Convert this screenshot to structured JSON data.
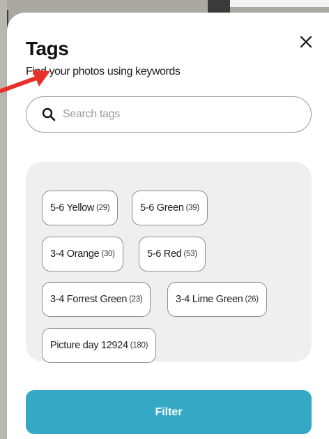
{
  "header": {
    "title": "Tags",
    "subtitle": "Find your photos using keywords",
    "close_icon": "close-icon"
  },
  "search": {
    "placeholder": "Search tags",
    "value": "",
    "icon": "search-icon"
  },
  "tags": [
    {
      "label": "5-6 Yellow",
      "count": "(29)"
    },
    {
      "label": "5-6 Green",
      "count": "(39)"
    },
    {
      "label": "3-4 Orange",
      "count": "(30)"
    },
    {
      "label": "5-6 Red",
      "count": "(53)"
    },
    {
      "label": "3-4 Forrest Green",
      "count": "(23)"
    },
    {
      "label": "3-4 Lime Green",
      "count": "(26)"
    },
    {
      "label": "Picture day 12924",
      "count": "(180)"
    }
  ],
  "actions": {
    "filter_label": "Filter"
  },
  "colors": {
    "accent": "#35a8c5",
    "annotation_arrow": "#e8302a",
    "tag_panel": "#eeefee"
  }
}
